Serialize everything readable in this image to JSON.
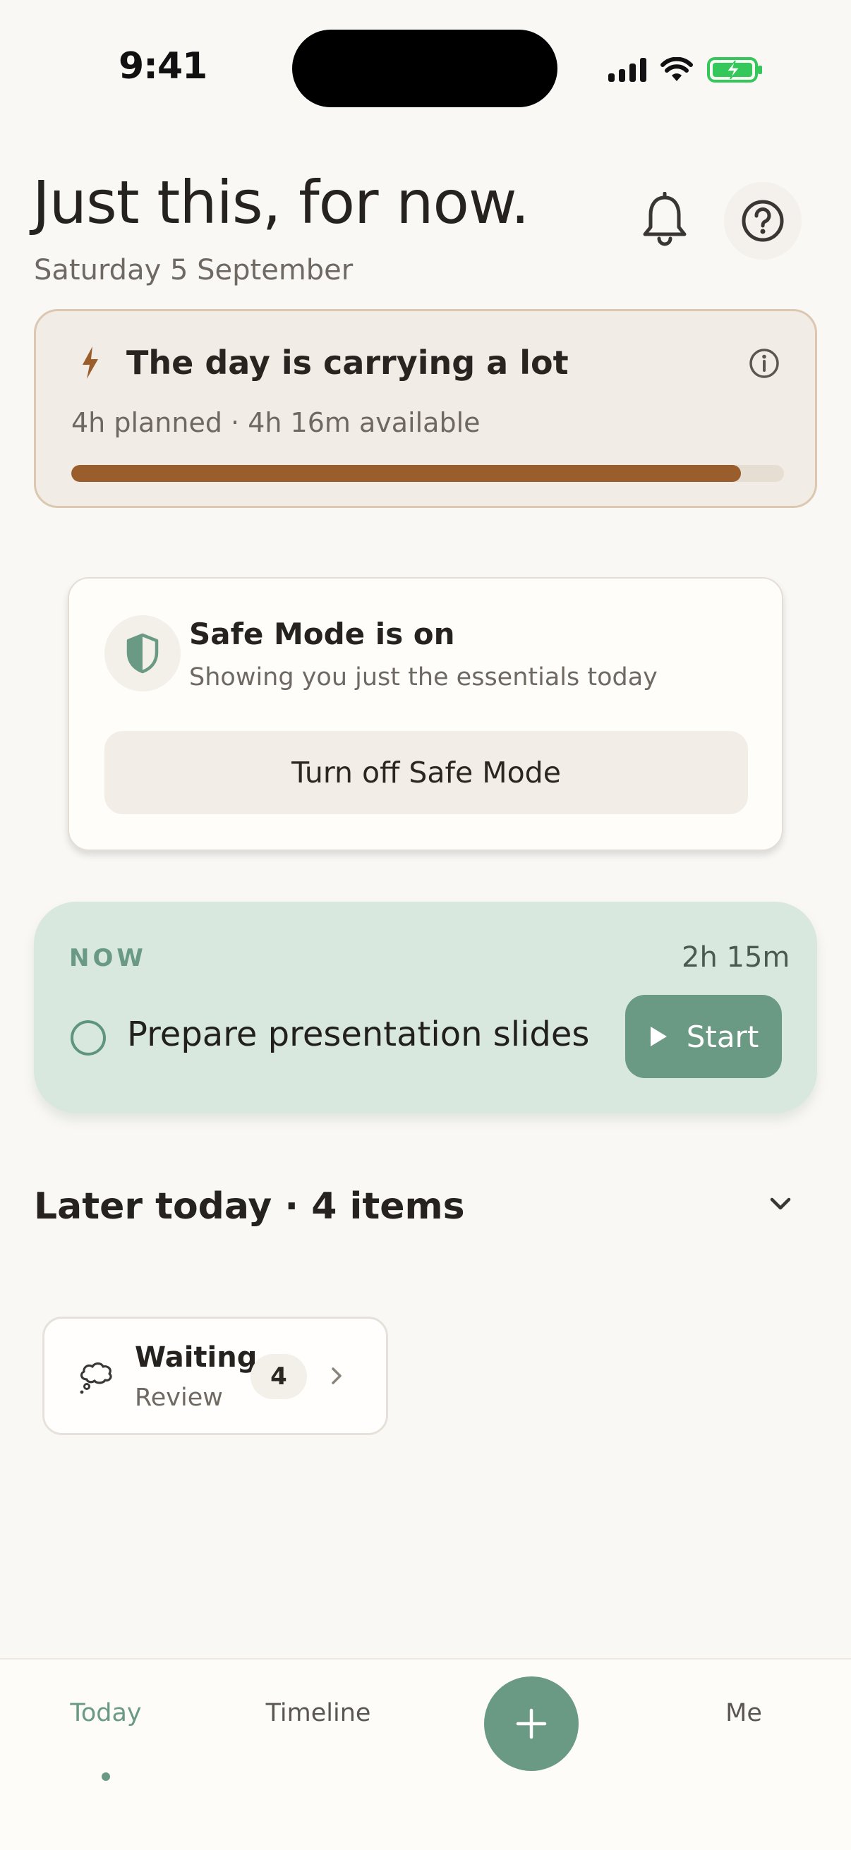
{
  "status_bar": {
    "time": "9:41"
  },
  "header": {
    "title": "Just this, for now.",
    "date": "Saturday 5 September",
    "icons": [
      "bell-icon",
      "help-icon"
    ]
  },
  "load_card": {
    "title": "The day is carrying a lot",
    "subtitle": "4h planned · 4h 16m available",
    "progress_fraction": 0.94,
    "accent_color": "#9a5e2c",
    "icons": [
      "bolt-icon",
      "info-icon"
    ]
  },
  "safe_mode": {
    "title": "Safe Mode is on",
    "subtitle": "Showing you just the essentials today",
    "button_label": "Turn off Safe Mode",
    "icon": "shield-icon"
  },
  "now": {
    "label": "NOW",
    "duration": "2h 15m",
    "task": "Prepare presentation slides",
    "start_label": "Start",
    "accent_color": "#6a9a84"
  },
  "later": {
    "title": "Later today · 4 items"
  },
  "waiting": {
    "title": "Waiting",
    "subtitle": "Review",
    "count": "4",
    "icon": "thought-cloud-icon"
  },
  "tabbar": {
    "tabs": [
      {
        "label": "Today",
        "active": true
      },
      {
        "label": "Timeline",
        "active": false
      },
      {
        "label": "Me",
        "active": false
      }
    ],
    "fab_icon": "plus-icon"
  }
}
